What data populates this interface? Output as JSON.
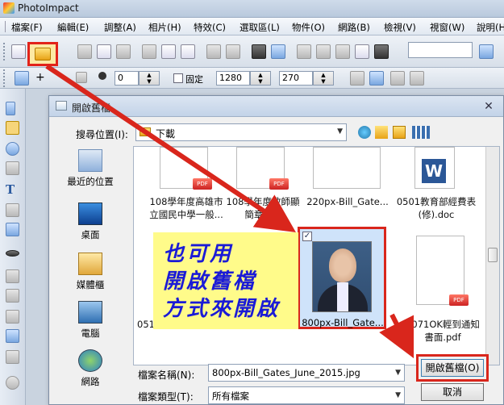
{
  "app": {
    "title": "PhotoImpact"
  },
  "menu": [
    {
      "label": "檔案(F)"
    },
    {
      "label": "編輯(E)"
    },
    {
      "label": "調整(A)"
    },
    {
      "label": "相片(H)"
    },
    {
      "label": "特效(C)"
    },
    {
      "label": "選取區(L)"
    },
    {
      "label": "物件(O)"
    },
    {
      "label": "網路(B)"
    },
    {
      "label": "檢視(V)"
    },
    {
      "label": "視窗(W)"
    },
    {
      "label": "說明(H)"
    }
  ],
  "toolbar2": {
    "value1": "0",
    "fixed_label": "固定",
    "width_value": "1280",
    "height_value": "270"
  },
  "dialog": {
    "title": "開啟舊檔",
    "lookin_label": "搜尋位置(I):",
    "lookin_value": "下載",
    "places": [
      {
        "label": "最近的位置"
      },
      {
        "label": "桌面"
      },
      {
        "label": "媒體櫃"
      },
      {
        "label": "電腦"
      },
      {
        "label": "網路"
      }
    ],
    "files": [
      {
        "name_line1": "108學年度高雄市",
        "name_line2": "立國民中學一般..."
      },
      {
        "name_line1": "108學年度教師顯",
        "name_line2": "簡章.pdf"
      },
      {
        "name_line1": "220px-Bill_Gate...",
        "name_line2": ""
      },
      {
        "name_line1": "0501教育部經費表",
        "name_line2": "(修).doc"
      },
      {
        "name_line1": "800px-Bill_Gate...",
        "name_line2": ""
      },
      {
        "name_line1": "1071OK輕到通知",
        "name_line2": "書面.pdf"
      },
      {
        "name_line1": "051",
        "name_line2": ""
      }
    ],
    "filename_label": "檔案名稱(N):",
    "filename_value": "800px-Bill_Gates_June_2015.jpg",
    "filetype_label": "檔案類型(T):",
    "filetype_value": "所有檔案",
    "open_button": "開啟舊檔(O)",
    "cancel_button": "取消"
  },
  "annotation": {
    "lines": [
      "也可用",
      "開啟舊檔",
      "方式來開啟"
    ],
    "text_color": "#1b1bd6",
    "background": "#fffb8a",
    "highlight_color": "#d9261c"
  }
}
